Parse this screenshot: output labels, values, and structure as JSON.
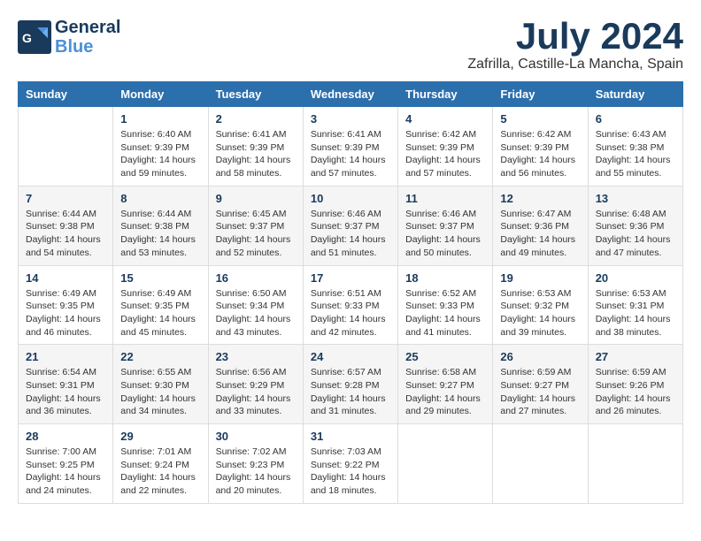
{
  "logo": {
    "general": "General",
    "blue": "Blue"
  },
  "title": {
    "month": "July 2024",
    "location": "Zafrilla, Castille-La Mancha, Spain"
  },
  "headers": [
    "Sunday",
    "Monday",
    "Tuesday",
    "Wednesday",
    "Thursday",
    "Friday",
    "Saturday"
  ],
  "weeks": [
    [
      {
        "day": "",
        "info": ""
      },
      {
        "day": "1",
        "info": "Sunrise: 6:40 AM\nSunset: 9:39 PM\nDaylight: 14 hours\nand 59 minutes."
      },
      {
        "day": "2",
        "info": "Sunrise: 6:41 AM\nSunset: 9:39 PM\nDaylight: 14 hours\nand 58 minutes."
      },
      {
        "day": "3",
        "info": "Sunrise: 6:41 AM\nSunset: 9:39 PM\nDaylight: 14 hours\nand 57 minutes."
      },
      {
        "day": "4",
        "info": "Sunrise: 6:42 AM\nSunset: 9:39 PM\nDaylight: 14 hours\nand 57 minutes."
      },
      {
        "day": "5",
        "info": "Sunrise: 6:42 AM\nSunset: 9:39 PM\nDaylight: 14 hours\nand 56 minutes."
      },
      {
        "day": "6",
        "info": "Sunrise: 6:43 AM\nSunset: 9:38 PM\nDaylight: 14 hours\nand 55 minutes."
      }
    ],
    [
      {
        "day": "7",
        "info": "Sunrise: 6:44 AM\nSunset: 9:38 PM\nDaylight: 14 hours\nand 54 minutes."
      },
      {
        "day": "8",
        "info": "Sunrise: 6:44 AM\nSunset: 9:38 PM\nDaylight: 14 hours\nand 53 minutes."
      },
      {
        "day": "9",
        "info": "Sunrise: 6:45 AM\nSunset: 9:37 PM\nDaylight: 14 hours\nand 52 minutes."
      },
      {
        "day": "10",
        "info": "Sunrise: 6:46 AM\nSunset: 9:37 PM\nDaylight: 14 hours\nand 51 minutes."
      },
      {
        "day": "11",
        "info": "Sunrise: 6:46 AM\nSunset: 9:37 PM\nDaylight: 14 hours\nand 50 minutes."
      },
      {
        "day": "12",
        "info": "Sunrise: 6:47 AM\nSunset: 9:36 PM\nDaylight: 14 hours\nand 49 minutes."
      },
      {
        "day": "13",
        "info": "Sunrise: 6:48 AM\nSunset: 9:36 PM\nDaylight: 14 hours\nand 47 minutes."
      }
    ],
    [
      {
        "day": "14",
        "info": "Sunrise: 6:49 AM\nSunset: 9:35 PM\nDaylight: 14 hours\nand 46 minutes."
      },
      {
        "day": "15",
        "info": "Sunrise: 6:49 AM\nSunset: 9:35 PM\nDaylight: 14 hours\nand 45 minutes."
      },
      {
        "day": "16",
        "info": "Sunrise: 6:50 AM\nSunset: 9:34 PM\nDaylight: 14 hours\nand 43 minutes."
      },
      {
        "day": "17",
        "info": "Sunrise: 6:51 AM\nSunset: 9:33 PM\nDaylight: 14 hours\nand 42 minutes."
      },
      {
        "day": "18",
        "info": "Sunrise: 6:52 AM\nSunset: 9:33 PM\nDaylight: 14 hours\nand 41 minutes."
      },
      {
        "day": "19",
        "info": "Sunrise: 6:53 AM\nSunset: 9:32 PM\nDaylight: 14 hours\nand 39 minutes."
      },
      {
        "day": "20",
        "info": "Sunrise: 6:53 AM\nSunset: 9:31 PM\nDaylight: 14 hours\nand 38 minutes."
      }
    ],
    [
      {
        "day": "21",
        "info": "Sunrise: 6:54 AM\nSunset: 9:31 PM\nDaylight: 14 hours\nand 36 minutes."
      },
      {
        "day": "22",
        "info": "Sunrise: 6:55 AM\nSunset: 9:30 PM\nDaylight: 14 hours\nand 34 minutes."
      },
      {
        "day": "23",
        "info": "Sunrise: 6:56 AM\nSunset: 9:29 PM\nDaylight: 14 hours\nand 33 minutes."
      },
      {
        "day": "24",
        "info": "Sunrise: 6:57 AM\nSunset: 9:28 PM\nDaylight: 14 hours\nand 31 minutes."
      },
      {
        "day": "25",
        "info": "Sunrise: 6:58 AM\nSunset: 9:27 PM\nDaylight: 14 hours\nand 29 minutes."
      },
      {
        "day": "26",
        "info": "Sunrise: 6:59 AM\nSunset: 9:27 PM\nDaylight: 14 hours\nand 27 minutes."
      },
      {
        "day": "27",
        "info": "Sunrise: 6:59 AM\nSunset: 9:26 PM\nDaylight: 14 hours\nand 26 minutes."
      }
    ],
    [
      {
        "day": "28",
        "info": "Sunrise: 7:00 AM\nSunset: 9:25 PM\nDaylight: 14 hours\nand 24 minutes."
      },
      {
        "day": "29",
        "info": "Sunrise: 7:01 AM\nSunset: 9:24 PM\nDaylight: 14 hours\nand 22 minutes."
      },
      {
        "day": "30",
        "info": "Sunrise: 7:02 AM\nSunset: 9:23 PM\nDaylight: 14 hours\nand 20 minutes."
      },
      {
        "day": "31",
        "info": "Sunrise: 7:03 AM\nSunset: 9:22 PM\nDaylight: 14 hours\nand 18 minutes."
      },
      {
        "day": "",
        "info": ""
      },
      {
        "day": "",
        "info": ""
      },
      {
        "day": "",
        "info": ""
      }
    ]
  ]
}
